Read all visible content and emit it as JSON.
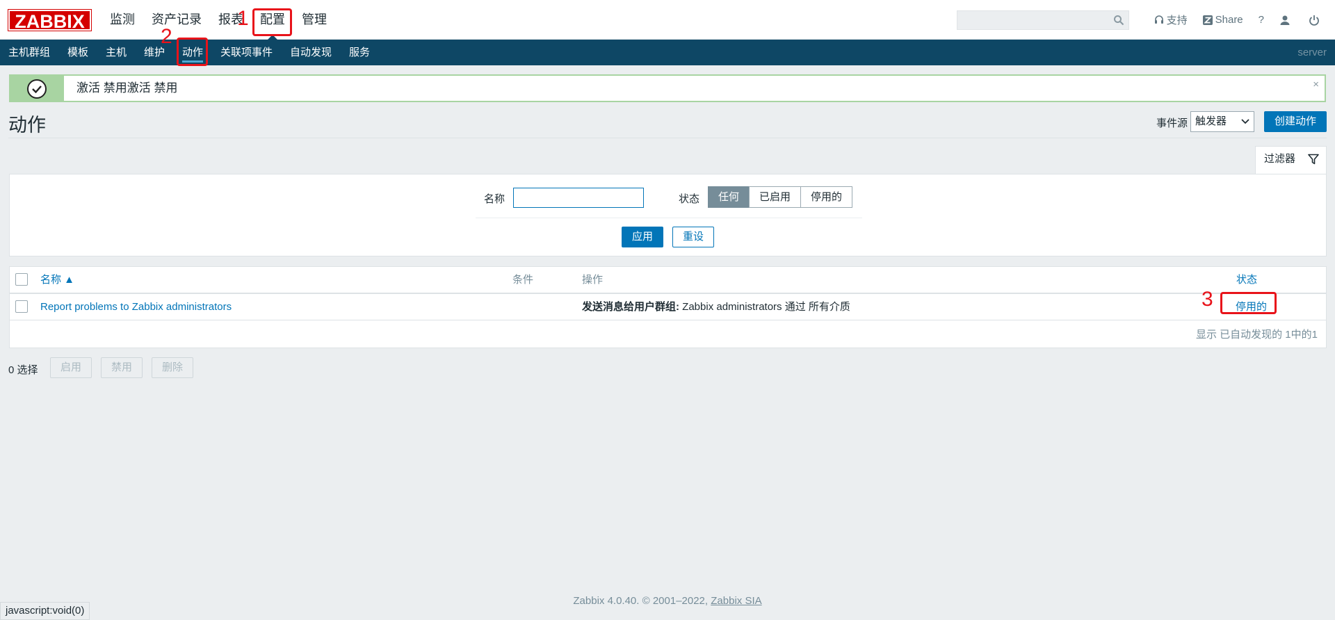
{
  "header": {
    "logo_text": "ZABBIX",
    "main_menu": [
      "监测",
      "资产记录",
      "报表",
      "配置",
      "管理"
    ],
    "search": {
      "value": "",
      "placeholder": ""
    },
    "tools": {
      "support": "支持",
      "share": "Share",
      "help": "?"
    }
  },
  "submenu": {
    "items": [
      "主机群组",
      "模板",
      "主机",
      "维护",
      "动作",
      "关联项事件",
      "自动发现",
      "服务"
    ],
    "selected": "动作",
    "server": "server"
  },
  "message": {
    "text": "激活 禁用激活 禁用",
    "close": "×"
  },
  "page": {
    "title": "动作",
    "event_source_label": "事件源",
    "event_source_value": "触发器",
    "create_button": "创建动作"
  },
  "filter": {
    "tab_label": "过滤器",
    "name_label": "名称",
    "name_value": "",
    "state_label": "状态",
    "state_options": [
      "任何",
      "已启用",
      "停用的"
    ],
    "state_selected": "任何",
    "apply": "应用",
    "reset": "重设"
  },
  "table": {
    "headers": {
      "name": "名称 ▲",
      "conditions": "条件",
      "operations": "操作",
      "status": "状态"
    },
    "rows": [
      {
        "name": "Report problems to Zabbix administrators",
        "conditions": "",
        "operations_bold": "发送消息给用户群组:",
        "operations_rest": " Zabbix administrators 通过 所有介质",
        "status": "停用的"
      }
    ],
    "pager": "显示 已自动发现的 1中的1"
  },
  "actions": {
    "selected_count": "0 选择",
    "enable": "启用",
    "disable": "禁用",
    "delete": "删除"
  },
  "footer": {
    "text": "Zabbix 4.0.40. © 2001–2022, ",
    "link": "Zabbix SIA"
  },
  "statusbar": "javascript:void(0)",
  "annotations": [
    "1",
    "2",
    "3"
  ],
  "colors": {
    "brand": "#d40000",
    "nav": "#0e4765",
    "accent": "#0275b8",
    "disabled_status": "#dc0000",
    "annotation": "#e8131a"
  }
}
